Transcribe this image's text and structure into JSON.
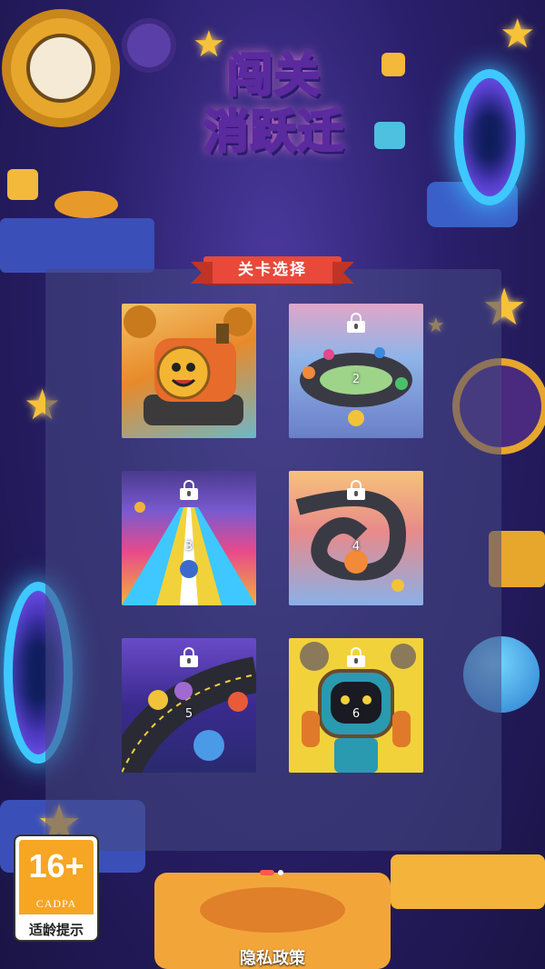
{
  "logo": {
    "line1": "闯关",
    "line2": "消跃迁"
  },
  "level_select": {
    "title": "关卡选择"
  },
  "levels": [
    {
      "number": "",
      "locked": false,
      "theme": "steam train"
    },
    {
      "number": "2",
      "locked": true,
      "theme": "race track loop"
    },
    {
      "number": "3",
      "locked": true,
      "theme": "rainbow road"
    },
    {
      "number": "4",
      "locked": true,
      "theme": "spiral road"
    },
    {
      "number": "5",
      "locked": true,
      "theme": "runner track"
    },
    {
      "number": "6",
      "locked": true,
      "theme": "robot"
    }
  ],
  "pagination": {
    "pages": 2,
    "current": 1
  },
  "age_rating": {
    "age": "16+",
    "org": "CADPA",
    "label": "适龄提示"
  },
  "footer": {
    "privacy": "隐私政策"
  },
  "colors": {
    "ribbon": "#e8493a",
    "accent": "#f7c23a",
    "portal": "#3ec8ff"
  }
}
